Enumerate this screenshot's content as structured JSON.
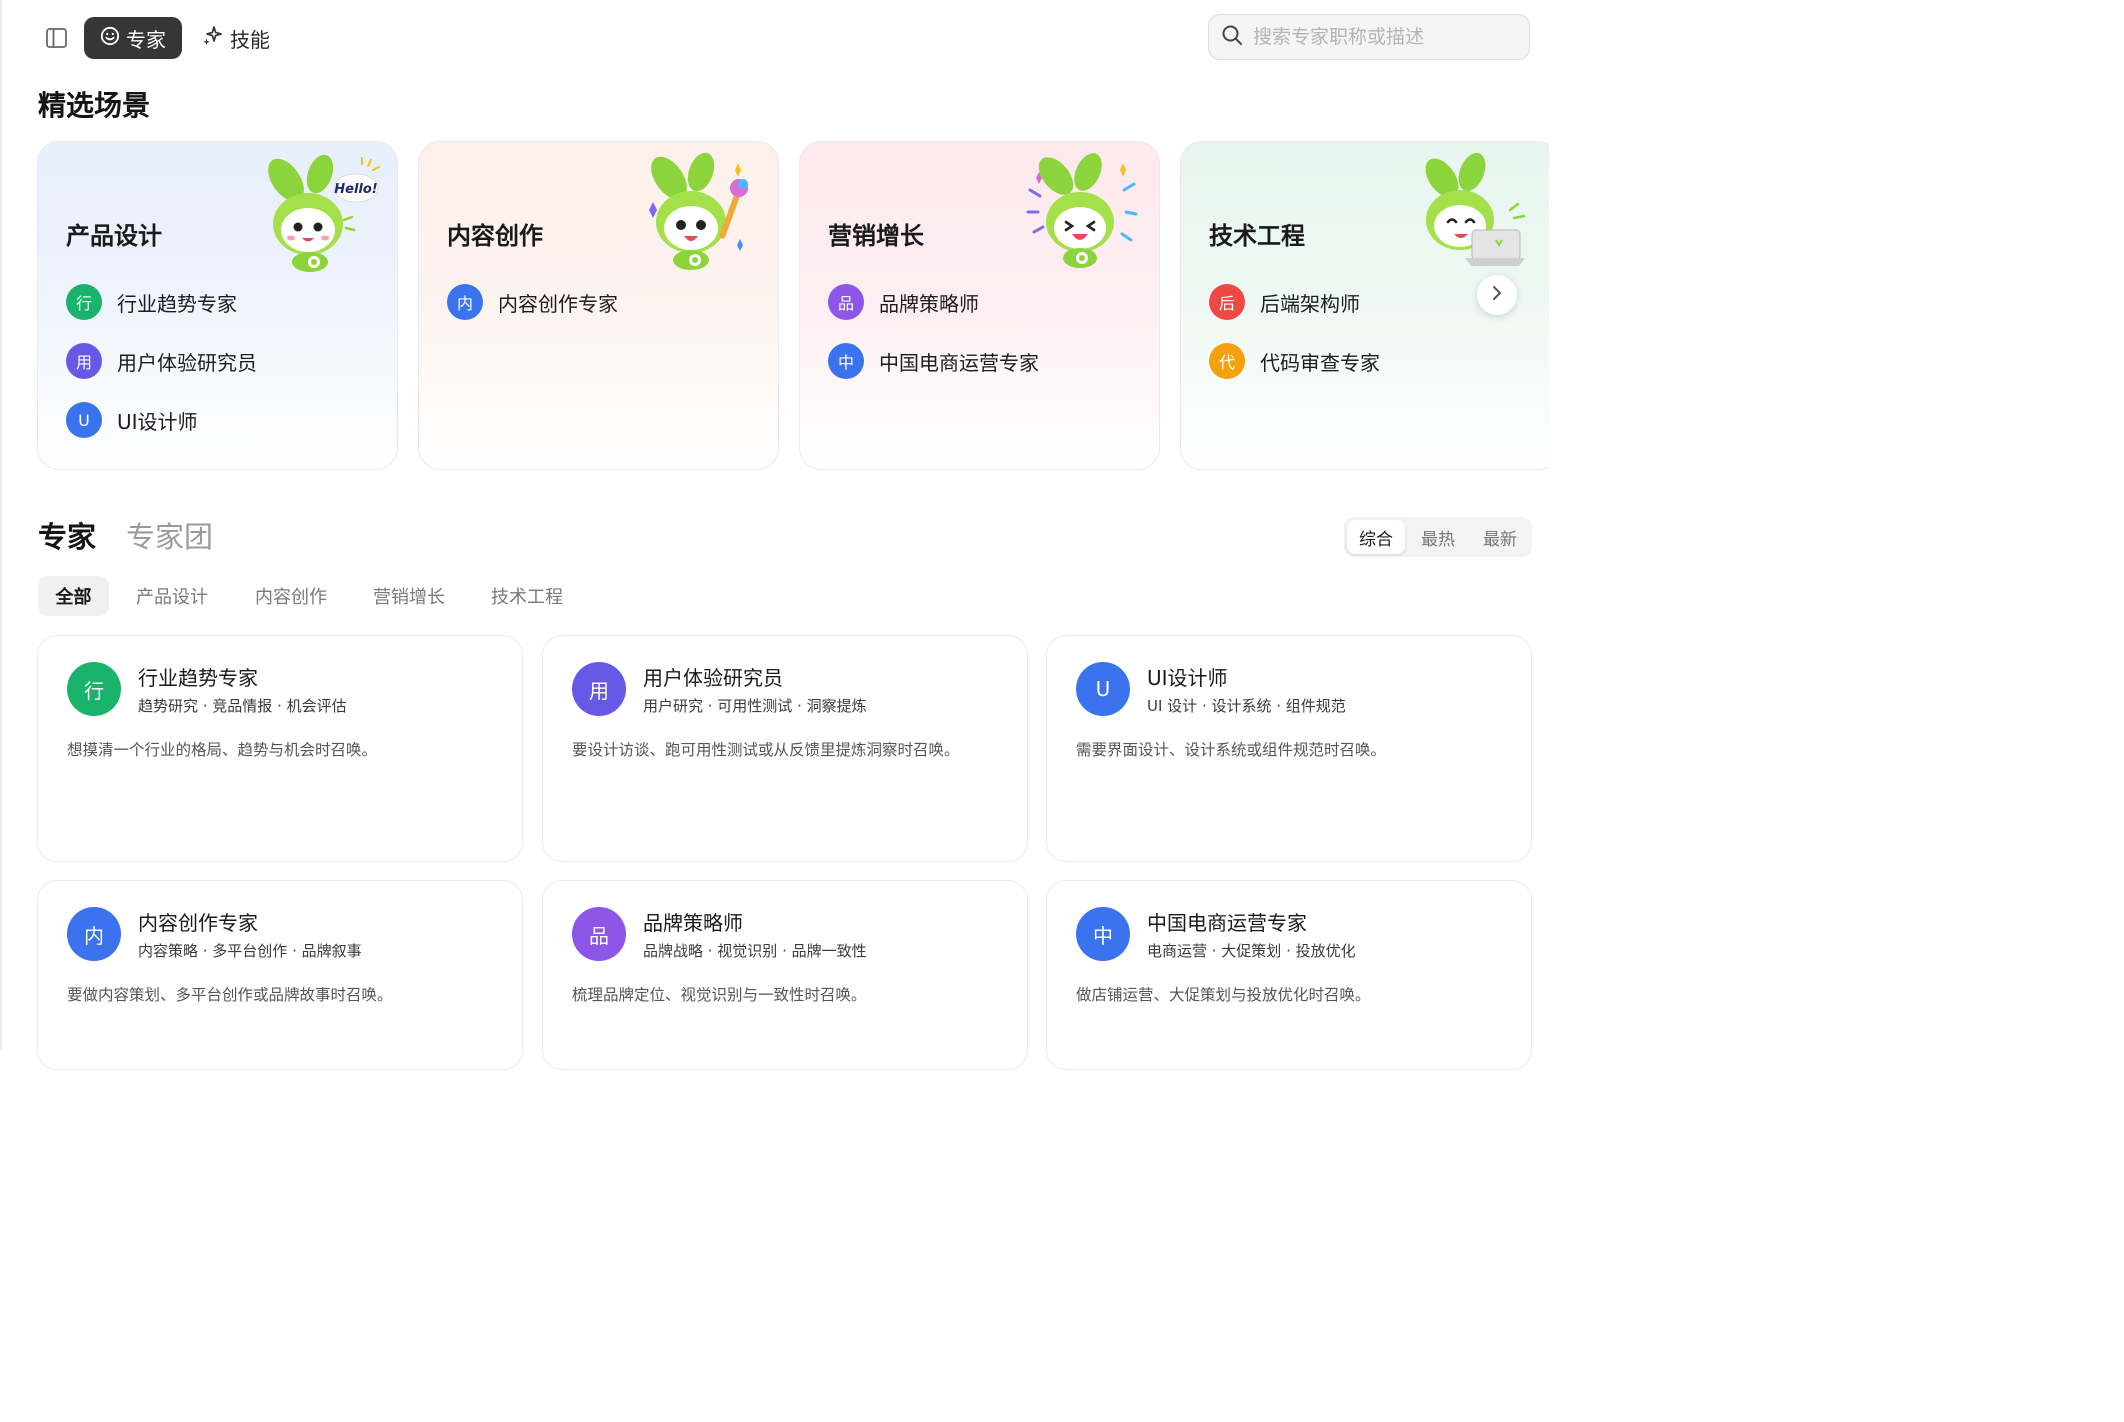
{
  "topbar": {
    "expert_tab": "专家",
    "skill_tab": "技能",
    "search_placeholder": "搜索专家职称或描述",
    "search_value": ""
  },
  "featured": {
    "title": "精选场景",
    "cards": [
      {
        "title": "产品设计",
        "items": [
          {
            "avatar": "行",
            "name": "行业趋势专家",
            "color": "#19b36b"
          },
          {
            "avatar": "用",
            "name": "用户体验研究员",
            "color": "#6659e8"
          },
          {
            "avatar": "U",
            "name": "UI设计师",
            "color": "#3b72ee"
          }
        ]
      },
      {
        "title": "内容创作",
        "items": [
          {
            "avatar": "内",
            "name": "内容创作专家",
            "color": "#3b72ee"
          }
        ]
      },
      {
        "title": "营销增长",
        "items": [
          {
            "avatar": "品",
            "name": "品牌策略师",
            "color": "#8d55e8"
          },
          {
            "avatar": "中",
            "name": "中国电商运营专家",
            "color": "#3b72ee"
          }
        ]
      },
      {
        "title": "技术工程",
        "items": [
          {
            "avatar": "后",
            "name": "后端架构师",
            "color": "#ee4a43"
          },
          {
            "avatar": "代",
            "name": "代码审查专家",
            "color": "#f5a10e"
          }
        ]
      }
    ]
  },
  "experts_section": {
    "tab_experts": "专家",
    "tab_teams": "专家团",
    "sort": [
      "综合",
      "最热",
      "最新"
    ],
    "filters": [
      "全部",
      "产品设计",
      "内容创作",
      "营销增长",
      "技术工程"
    ],
    "cards": [
      {
        "avatar": "行",
        "name": "行业趋势专家",
        "tags": "趋势研究 · 竞品情报 · 机会评估",
        "desc": "想摸清一个行业的格局、趋势与机会时召唤。",
        "color": "#19b36b"
      },
      {
        "avatar": "用",
        "name": "用户体验研究员",
        "tags": "用户研究 · 可用性测试 · 洞察提炼",
        "desc": "要设计访谈、跑可用性测试或从反馈里提炼洞察时召唤。",
        "color": "#6659e8"
      },
      {
        "avatar": "U",
        "name": "UI设计师",
        "tags": "UI 设计 · 设计系统 · 组件规范",
        "desc": "需要界面设计、设计系统或组件规范时召唤。",
        "color": "#3b72ee"
      },
      {
        "avatar": "内",
        "name": "内容创作专家",
        "tags": "内容策略 · 多平台创作 · 品牌叙事",
        "desc": "要做内容策划、多平台创作或品牌故事时召唤。",
        "color": "#3b72ee"
      },
      {
        "avatar": "品",
        "name": "品牌策略师",
        "tags": "品牌战略 · 视觉识别 · 品牌一致性",
        "desc": "梳理品牌定位、视觉识别与一致性时召唤。",
        "color": "#8d55e8"
      },
      {
        "avatar": "中",
        "name": "中国电商运营专家",
        "tags": "电商运营 · 大促策划 · 投放优化",
        "desc": "做店铺运营、大促策划与投放优化时召唤。",
        "color": "#3b72ee"
      }
    ]
  },
  "mascot_bubble": "Hello!"
}
